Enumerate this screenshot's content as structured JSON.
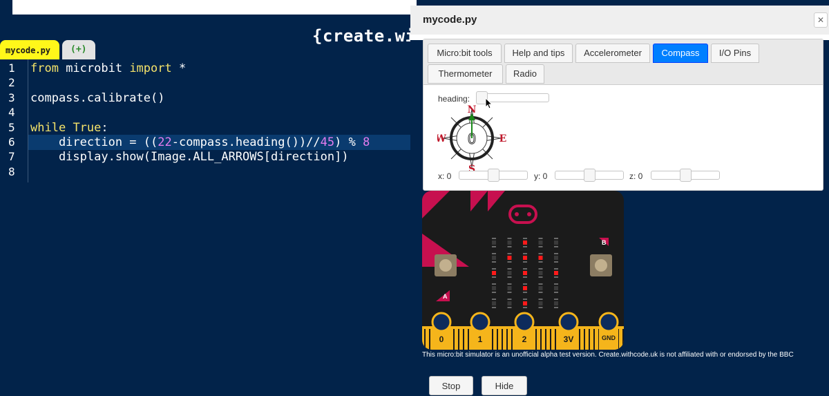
{
  "brand": "{create.wi",
  "editor": {
    "tabs": [
      {
        "label": "mycode.py"
      },
      {
        "label": "(+)"
      }
    ],
    "line_numbers": [
      "1",
      "2",
      "3",
      "4",
      "5",
      "6",
      "7",
      "8"
    ],
    "lines": [
      [
        {
          "t": "from",
          "c": "kw"
        },
        {
          "t": " microbit ",
          "c": ""
        },
        {
          "t": "import",
          "c": "kw"
        },
        {
          "t": " *",
          "c": ""
        }
      ],
      [],
      [
        {
          "t": "compass.calibrate()",
          "c": ""
        }
      ],
      [],
      [
        {
          "t": "while",
          "c": "kw"
        },
        {
          "t": " ",
          "c": ""
        },
        {
          "t": "True",
          "c": "kw"
        },
        {
          "t": ":",
          "c": ""
        }
      ],
      [
        {
          "t": "    direction = ((",
          "c": ""
        },
        {
          "t": "22",
          "c": "num"
        },
        {
          "t": "-compass.heading())//",
          "c": ""
        },
        {
          "t": "45",
          "c": "num"
        },
        {
          "t": ") % ",
          "c": ""
        },
        {
          "t": "8",
          "c": "num"
        }
      ],
      [
        {
          "t": "    display.show(Image.ALL_ARROWS[direction])",
          "c": ""
        }
      ],
      []
    ],
    "highlighted_line": 6
  },
  "modal": {
    "title": "mycode.py",
    "close_label": "✕",
    "tabs": [
      {
        "label": "Micro:bit tools",
        "active": false
      },
      {
        "label": "Help and tips",
        "active": false
      },
      {
        "label": "Accelerometer",
        "active": false
      },
      {
        "label": "Compass",
        "active": true
      },
      {
        "label": "I/O Pins",
        "active": false
      },
      {
        "label": "Thermometer",
        "active": false
      },
      {
        "label": "Radio",
        "active": false
      }
    ],
    "compass": {
      "heading_label": "heading:",
      "heading_value": 0,
      "needle_letter": "0",
      "points": {
        "n": "N",
        "e": "E",
        "s": "S",
        "w": "W"
      },
      "x_label": "x: 0",
      "y_label": "y: 0",
      "z_label": "z: 0",
      "x_value": 0,
      "y_value": 0,
      "z_value": 0
    },
    "microbit": {
      "pins": [
        "0",
        "1",
        "2",
        "3V",
        "GND"
      ],
      "button_a": "A",
      "button_b": "B",
      "leds": [
        [
          0,
          0,
          1,
          0,
          0
        ],
        [
          0,
          1,
          1,
          1,
          0
        ],
        [
          1,
          0,
          1,
          0,
          1
        ],
        [
          0,
          0,
          1,
          0,
          0
        ],
        [
          0,
          0,
          1,
          0,
          0
        ]
      ],
      "accent_color": "#c7104f",
      "gold_color": "#f5b51b"
    },
    "disclaimer": "This micro:bit simulator is an unofficial alpha test version. Create.withcode.uk is not affiliated with or endorsed by the BBC",
    "buttons": {
      "stop": "Stop",
      "hide": "Hide"
    }
  }
}
